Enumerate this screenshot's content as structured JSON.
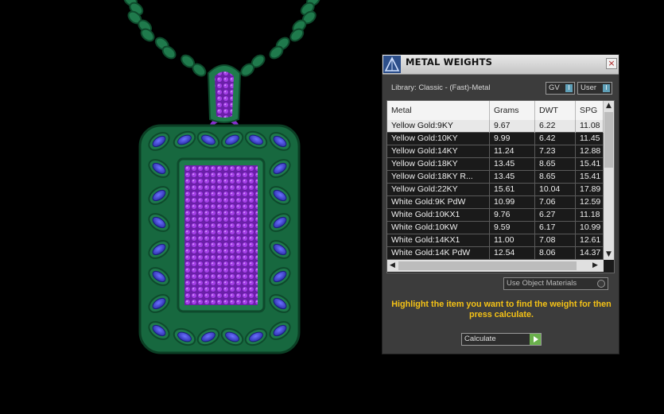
{
  "panel": {
    "title": "METAL WEIGHTS",
    "close_label": "×",
    "library": "Library: Classic - (Fast)-Metal",
    "gv_label": "GV",
    "gv_indicator": "I",
    "user_label": "User",
    "user_indicator": "I",
    "columns": [
      "Metal",
      "Grams",
      "DWT",
      "SPG"
    ],
    "rows": [
      [
        "Yellow Gold:9KY",
        "9.67",
        "6.22",
        "11.08"
      ],
      [
        "Yellow Gold:10KY",
        "9.99",
        "6.42",
        "11.45"
      ],
      [
        "Yellow Gold:14KY",
        "11.24",
        "7.23",
        "12.88"
      ],
      [
        "Yellow Gold:18KY",
        "13.45",
        "8.65",
        "15.41"
      ],
      [
        "Yellow Gold:18KY R...",
        "13.45",
        "8.65",
        "15.41"
      ],
      [
        "Yellow Gold:22KY",
        "15.61",
        "10.04",
        "17.89"
      ],
      [
        "White Gold:9K PdW",
        "10.99",
        "7.06",
        "12.59"
      ],
      [
        "White Gold:10KX1",
        "9.76",
        "6.27",
        "11.18"
      ],
      [
        "White Gold:10KW",
        "9.59",
        "6.17",
        "10.99"
      ],
      [
        "White Gold:14KX1",
        "11.00",
        "7.08",
        "12.61"
      ],
      [
        "White Gold:14K PdW",
        "12.54",
        "8.06",
        "14.37"
      ]
    ],
    "selected_row": 0,
    "scroll_up": "▲",
    "scroll_down": "▼",
    "scroll_left": "◀",
    "scroll_right": "▶",
    "use_object_materials": "Use Object Materials",
    "hint": "Highlight the item you want to find the weight for then press calculate.",
    "calculate_label": "Calculate"
  },
  "colors": {
    "metal": "#1f7a4c",
    "metal_dark": "#0e4a2c",
    "gem": "#3a3ec8",
    "gem_purple": "#8a2ed0",
    "hint": "#f5c216",
    "accent": "#5fa0b8"
  },
  "icons": {
    "logo": "matrix-app-icon",
    "close": "close-icon",
    "calculate_go": "play-arrow-icon"
  }
}
